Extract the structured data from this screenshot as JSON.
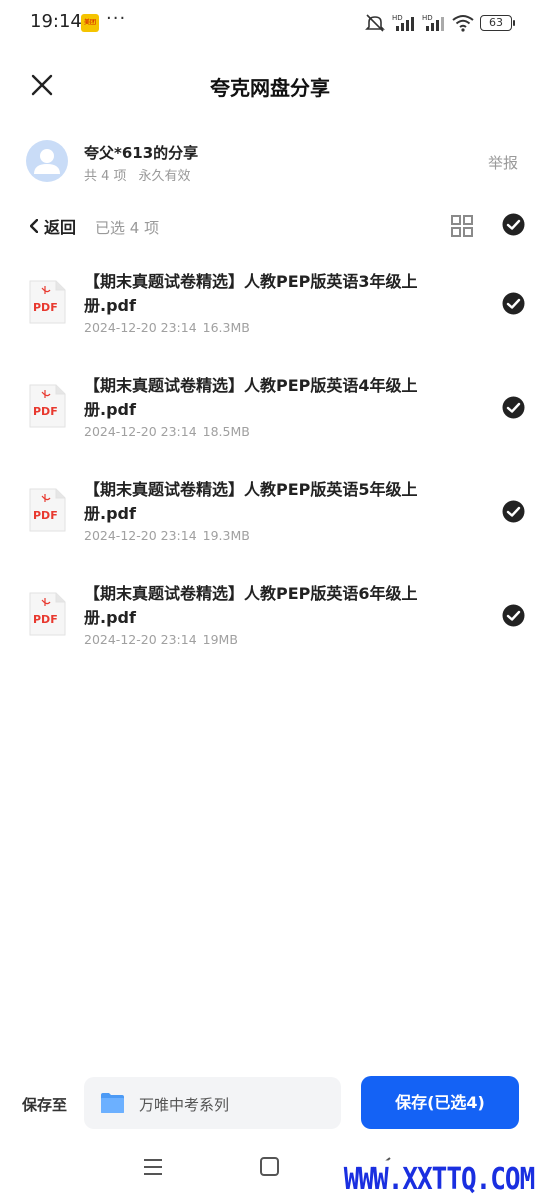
{
  "status_bar": {
    "time": "19:14",
    "app_badge": "美团",
    "more": "···",
    "battery": "63",
    "icons": [
      "mute-icon",
      "signal-hd-icon",
      "signal-hd-icon",
      "wifi-icon",
      "battery-icon"
    ]
  },
  "header": {
    "title": "夸克网盘分享",
    "close_icon": "close-icon"
  },
  "sharer": {
    "name": "夸父*613的分享",
    "count": "共 4 项",
    "validity": "永久有效",
    "report": "举报"
  },
  "toolbar": {
    "back": "返回",
    "selected": "已选 4 项",
    "grid_icon": "grid-view-icon",
    "check_all_icon": "check-circle-icon"
  },
  "files": [
    {
      "name": "【期末真题试卷精选】人教PEP版英语3年级上册.pdf",
      "date": "2024-12-20 23:14",
      "size": "16.3MB",
      "selected": true
    },
    {
      "name": "【期末真题试卷精选】人教PEP版英语4年级上册.pdf",
      "date": "2024-12-20 23:14",
      "size": "18.5MB",
      "selected": true
    },
    {
      "name": "【期末真题试卷精选】人教PEP版英语5年级上册.pdf",
      "date": "2024-12-20 23:14",
      "size": "19.3MB",
      "selected": true
    },
    {
      "name": "【期末真题试卷精选】人教PEP版英语6年级上册.pdf",
      "date": "2024-12-20 23:14",
      "size": "19MB",
      "selected": true
    }
  ],
  "file_icon_label": "PDF",
  "bottom_bar": {
    "save_to": "保存至",
    "folder": "万唯中考系列",
    "save_button": "保存(已选4)"
  },
  "watermark": "WWW.XXTTQ.COM",
  "colors": {
    "accent": "#1462f5",
    "pdf_red": "#e8392f",
    "folder_blue": "#4c9af5",
    "watermark_blue": "#1a2fe0"
  }
}
